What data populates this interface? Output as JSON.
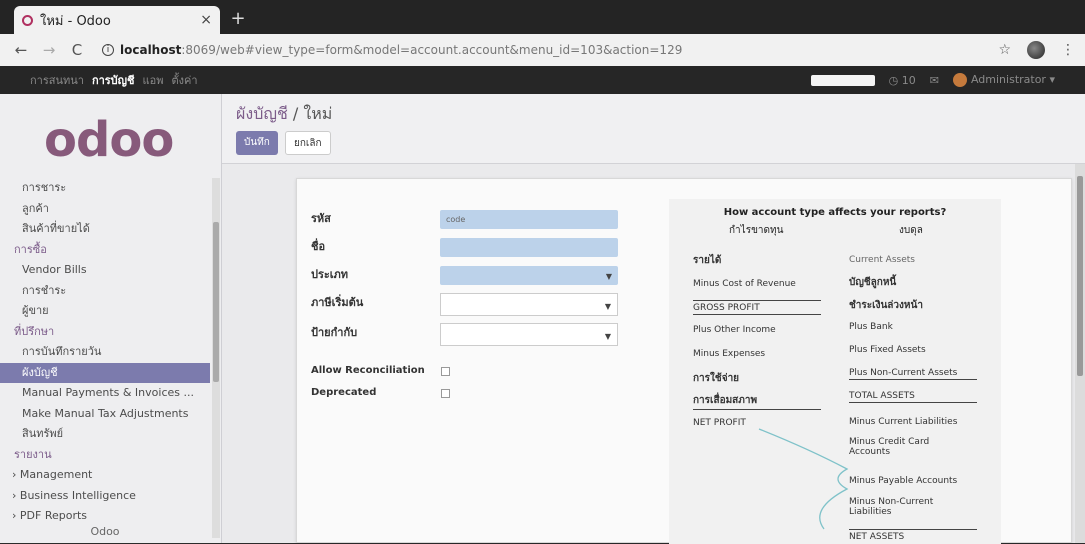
{
  "browser": {
    "tab_title": "ใหม่ - Odoo",
    "tab_close": "×",
    "new_tab": "+",
    "url_host": "localhost",
    "url_rest": ":8069/web#view_type=form&model=account.account&menu_id=103&action=129",
    "icons": [
      "back-icon",
      "forward-icon",
      "reload-icon",
      "info-icon",
      "star-icon",
      "extension-icon",
      "menu-icon"
    ]
  },
  "topbar": {
    "menu": [
      "การสนทนา",
      "การบัญชี",
      "แอพ",
      "ตั้งค่า"
    ],
    "active_index": 1,
    "messages_count": "10",
    "user": "Administrator"
  },
  "sidebar": {
    "logo": "odoo",
    "items": [
      {
        "label": "การชาระ",
        "type": "item"
      },
      {
        "label": "ลูกค้า",
        "type": "item"
      },
      {
        "label": "สินค้าที่ขายได้",
        "type": "item"
      },
      {
        "label": "การซื้อ",
        "type": "heading"
      },
      {
        "label": "Vendor Bills",
        "type": "item"
      },
      {
        "label": "การชำระ",
        "type": "item"
      },
      {
        "label": "ผู้ขาย",
        "type": "item"
      },
      {
        "label": "ที่ปรึกษา",
        "type": "heading"
      },
      {
        "label": "การบันทึกรายวัน",
        "type": "item"
      },
      {
        "label": "ผังบัญชี",
        "type": "active"
      },
      {
        "label": "Manual Payments & Invoices ...",
        "type": "item"
      },
      {
        "label": "Make Manual Tax Adjustments",
        "type": "item"
      },
      {
        "label": "สินทรัพย์",
        "type": "item"
      },
      {
        "label": "รายงาน",
        "type": "heading"
      },
      {
        "label": "Management",
        "type": "collapsible"
      },
      {
        "label": "Business Intelligence",
        "type": "collapsible"
      },
      {
        "label": "PDF Reports",
        "type": "collapsible"
      }
    ],
    "footer": "Odoo"
  },
  "control_panel": {
    "breadcrumb_parent": "ผังบัญชี",
    "breadcrumb_sep": " / ",
    "breadcrumb_current": "ใหม่",
    "save_label": "บันทึก",
    "discard_label": "ยกเลิก"
  },
  "form": {
    "code_label": "รหัส",
    "code_placeholder": "code",
    "name_label": "ชื่อ",
    "type_label": "ประเภท",
    "tax_label": "ภาษีเริ่มต้น",
    "tags_label": "ป้ายกำกับ",
    "reconcile_label": "Allow Reconciliation",
    "deprecated_label": "Deprecated"
  },
  "help": {
    "title": "How account type affects your reports?",
    "left_title": "กำไรขาดทุน",
    "right_title": "งบดุล",
    "left": [
      "รายได้",
      "Minus Cost of Revenue",
      "GROSS PROFIT",
      "Plus Other Income",
      "Minus Expenses",
      "การใช้จ่าย",
      "การเสื่อมสภาพ",
      "NET PROFIT"
    ],
    "right": [
      "Current Assets",
      "บัญชีลูกหนี้",
      "ชำระเงินล่วงหน้า",
      "Plus Bank",
      "Plus Fixed Assets",
      "Plus Non-Current Assets",
      "TOTAL ASSETS",
      "Minus Current Liabilities",
      "Minus Credit Card Accounts",
      "Minus Payable Accounts",
      "Minus Non-Current Liabilities",
      "NET ASSETS"
    ],
    "link_color": "#7fc2c9"
  },
  "colors": {
    "brand": "#875a7b",
    "primary_button": "#7c7bad",
    "required_field": "#bcd2ea"
  }
}
